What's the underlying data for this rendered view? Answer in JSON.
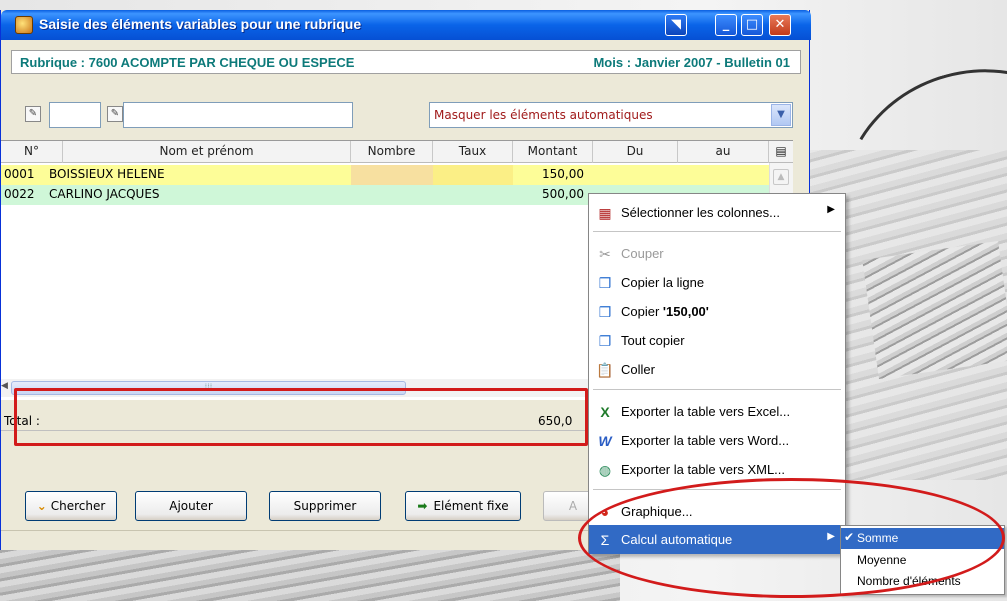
{
  "window": {
    "title": "Saisie des éléments variables pour une rubrique",
    "rubrique": "Rubrique : 7600  ACOMPTE PAR CHEQUE OU ESPECE",
    "mois": "Mois : Janvier 2007 - Bulletin 01",
    "filter_combo": "Masquer les éléments automatiques"
  },
  "table": {
    "columns": [
      "N°",
      "Nom et prénom",
      "Nombre",
      "Taux",
      "Montant",
      "Du",
      "au"
    ],
    "rows": [
      {
        "num": "0001",
        "name": "BOISSIEUX HELENE",
        "montant": "150,00"
      },
      {
        "num": "0022",
        "name": "CARLINO JACQUES",
        "montant": "500,00"
      }
    ],
    "total_label": "Total :",
    "total_value": "650,0"
  },
  "buttons": {
    "chercher": "Chercher",
    "ajouter": "Ajouter",
    "supprimer": "Supprimer",
    "element_fixe": "Elément fixe",
    "partial": "A"
  },
  "context_menu": {
    "items": [
      {
        "label": "Sélectionner les colonnes...",
        "icon": "columns-icon",
        "submenu": true
      },
      {
        "label": "Couper",
        "icon": "scissors-icon",
        "disabled": true
      },
      {
        "label": "Copier la ligne",
        "icon": "copy-icon"
      },
      {
        "label_prefix": "Copier ",
        "label_bold": "'150,00'",
        "icon": "copy-icon"
      },
      {
        "label": "Tout copier",
        "icon": "copy-all-icon"
      },
      {
        "label": "Coller",
        "icon": "paste-icon"
      },
      {
        "label": "Exporter la table vers Excel...",
        "icon": "excel-icon"
      },
      {
        "label": "Exporter la table vers Word...",
        "icon": "word-icon"
      },
      {
        "label": "Exporter la table vers XML...",
        "icon": "xml-icon"
      },
      {
        "label": "Graphique...",
        "icon": "chart-icon"
      },
      {
        "label": "Calcul automatique",
        "icon": "sum-icon",
        "submenu": true,
        "selected": true
      }
    ]
  },
  "submenu": {
    "items": [
      "Somme",
      "Moyenne",
      "Nombre d'éléments"
    ],
    "checked": "Somme"
  },
  "colors": {
    "titlebar": "#0a5fe0",
    "highlight": "#316ac5",
    "row_yellow": "#fdfd98",
    "row_green": "#cff7d8",
    "annotation_red": "#d21b1b",
    "rubrique_text": "#0d7a7a"
  }
}
